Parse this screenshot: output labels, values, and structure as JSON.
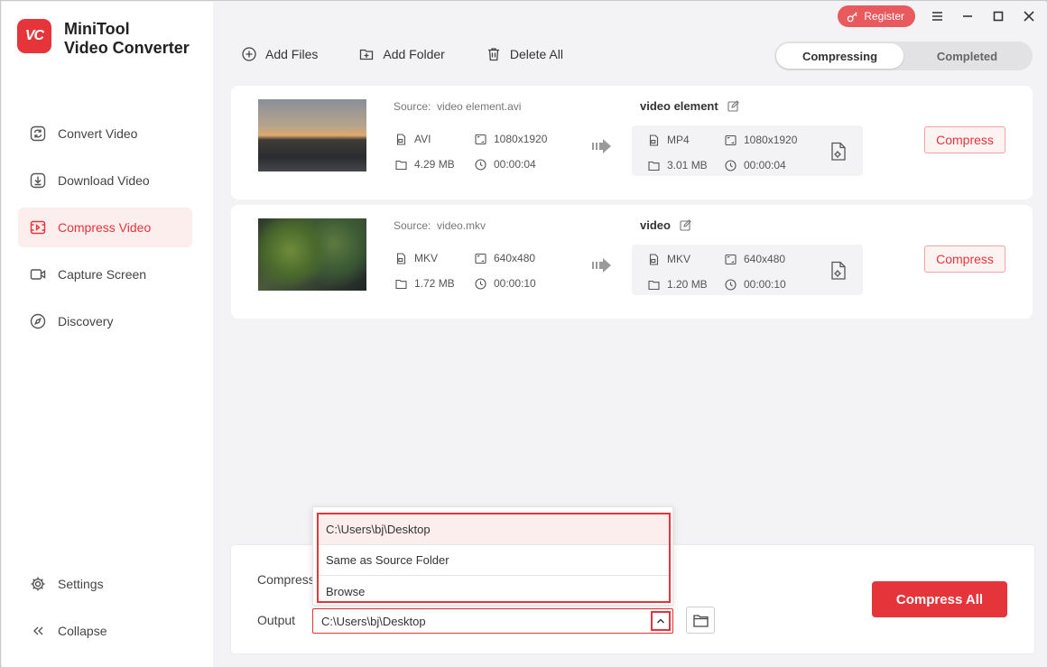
{
  "app": {
    "logo_text": "VC",
    "brand_line1": "MiniTool",
    "brand_line2": "Video Converter"
  },
  "sidebar": {
    "items": [
      {
        "label": "Convert Video",
        "icon": "convert-icon",
        "active": false
      },
      {
        "label": "Download Video",
        "icon": "download-icon",
        "active": false
      },
      {
        "label": "Compress Video",
        "icon": "compress-icon",
        "active": true
      },
      {
        "label": "Capture Screen",
        "icon": "camera-icon",
        "active": false
      },
      {
        "label": "Discovery",
        "icon": "compass-icon",
        "active": false
      }
    ],
    "settings_label": "Settings",
    "collapse_label": "Collapse"
  },
  "topbar": {
    "register_label": "Register"
  },
  "toolbar": {
    "add_files": "Add Files",
    "add_folder": "Add Folder",
    "delete_all": "Delete All"
  },
  "tabs": {
    "compressing": "Compressing",
    "completed": "Completed"
  },
  "files": [
    {
      "source_label": "Source:",
      "source_name": "video element.avi",
      "src_format": "AVI",
      "src_resolution": "1080x1920",
      "src_size": "4.29 MB",
      "src_duration": "00:00:04",
      "out_name": "video element",
      "out_format": "MP4",
      "out_resolution": "1080x1920",
      "out_size": "3.01 MB",
      "out_duration": "00:00:04",
      "button": "Compress"
    },
    {
      "source_label": "Source:",
      "source_name": "video.mkv",
      "src_format": "MKV",
      "src_resolution": "640x480",
      "src_size": "1.72 MB",
      "src_duration": "00:00:10",
      "out_name": "video",
      "out_format": "MKV",
      "out_resolution": "640x480",
      "out_size": "1.20 MB",
      "out_duration": "00:00:10",
      "button": "Compress"
    }
  ],
  "bottom": {
    "compress_label": "Compress",
    "output_label": "Output",
    "output_value": "C:\\Users\\bj\\Desktop",
    "compress_all": "Compress All"
  },
  "dropdown": {
    "options": [
      "C:\\Users\\bj\\Desktop",
      "Same as Source Folder",
      "Browse"
    ]
  },
  "colors": {
    "accent": "#e5343a",
    "accent_light": "#fdeeee"
  }
}
